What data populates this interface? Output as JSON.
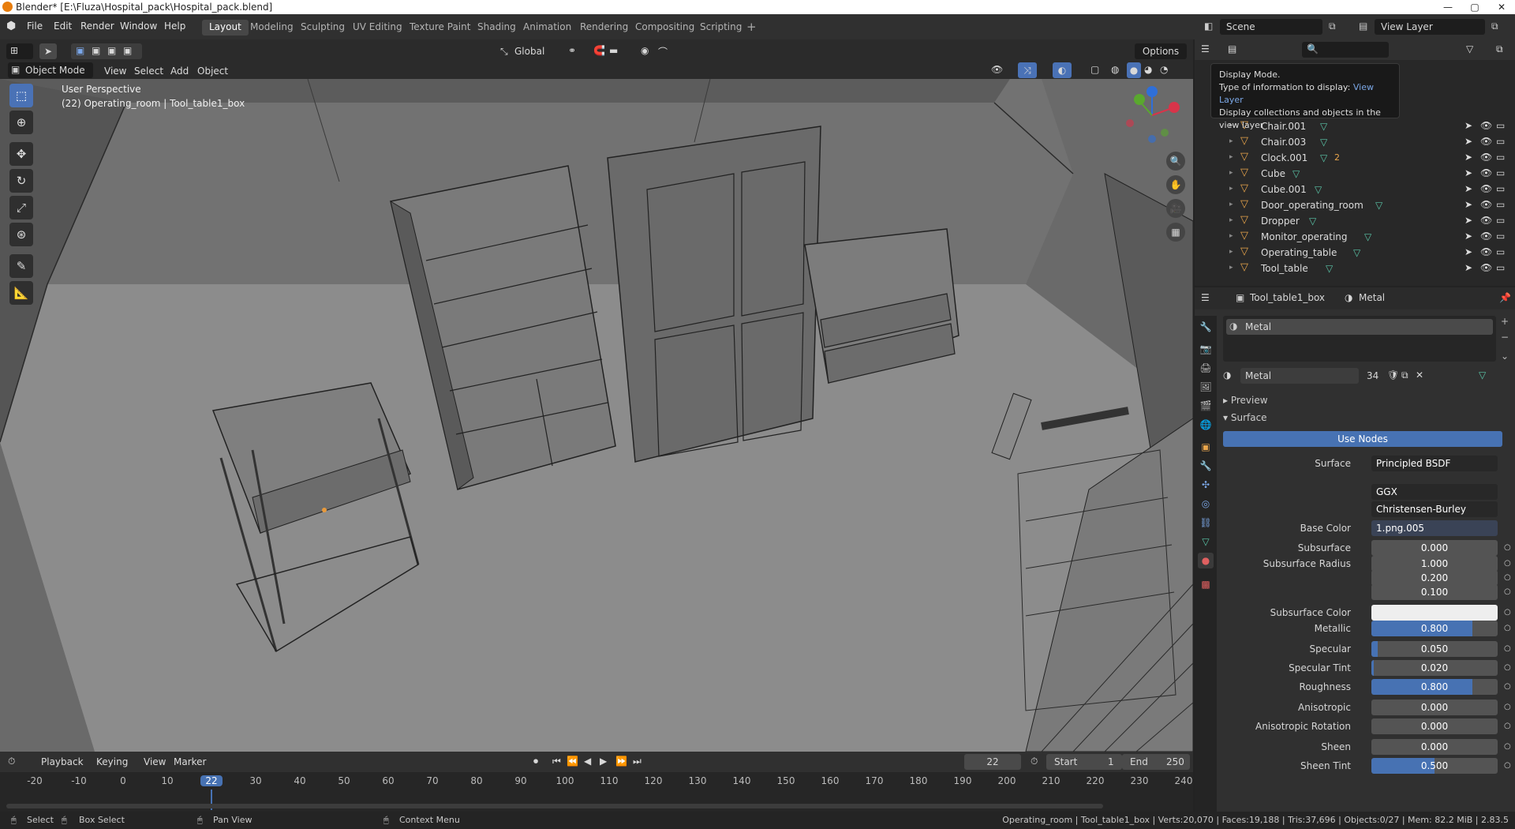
{
  "titlebar": {
    "title": "Blender* [E:\\Fluza\\Hospital_pack\\Hospital_pack.blend]",
    "btn_min": "—",
    "btn_max": "▢",
    "btn_close": "✕"
  },
  "menu": {
    "items": [
      "File",
      "Edit",
      "Render",
      "Window",
      "Help"
    ]
  },
  "workspaces": {
    "tabs": [
      "Layout",
      "Modeling",
      "Sculpting",
      "UV Editing",
      "Texture Paint",
      "Shading",
      "Animation",
      "Rendering",
      "Compositing",
      "Scripting"
    ],
    "active": "Layout",
    "add": "+"
  },
  "scene": {
    "label": "Scene",
    "view_layer": "View Layer"
  },
  "viewport_header": {
    "transform_orientation": "Global",
    "options": "Options",
    "mode": "Object Mode",
    "menus": [
      "View",
      "Select",
      "Add",
      "Object"
    ]
  },
  "viewport": {
    "perspective_label": "User Perspective",
    "object_label": "(22) Operating_room | Tool_table1_box"
  },
  "tooltip": {
    "title": "Display Mode.",
    "line2_prefix": "Type of information to display:",
    "line2_value": "View Layer",
    "line3": "Display collections and objects in the view layer"
  },
  "outliner": {
    "items": [
      {
        "name": "Chair.001",
        "extra": ""
      },
      {
        "name": "Chair.003",
        "extra": ""
      },
      {
        "name": "Clock.001",
        "extra": "2"
      },
      {
        "name": "Cube",
        "extra": ""
      },
      {
        "name": "Cube.001",
        "extra": ""
      },
      {
        "name": "Door_operating_room",
        "extra": ""
      },
      {
        "name": "Dropper",
        "extra": ""
      },
      {
        "name": "Monitor_operating",
        "extra": ""
      },
      {
        "name": "Operating_table",
        "extra": ""
      },
      {
        "name": "Tool_table",
        "extra": ""
      }
    ]
  },
  "properties": {
    "object_name": "Tool_table1_box",
    "material_name": "Metal",
    "slot_name": "Metal",
    "material_field": "Metal",
    "user_count": "34",
    "panel_preview": "Preview",
    "panel_surface": "Surface",
    "use_nodes": "Use Nodes",
    "surface_label": "Surface",
    "surface_value": "Principled BSDF",
    "distribution": "GGX",
    "subsurface_method": "Christensen-Burley",
    "base_color_label": "Base Color",
    "base_color_value": "1.png.005",
    "rows": [
      {
        "label": "Subsurface",
        "value": "0.000",
        "fill": 0
      },
      {
        "label": "Subsurface Radius",
        "value": "1.000",
        "fill": 0
      },
      {
        "label": "",
        "value": "0.200",
        "fill": 0
      },
      {
        "label": "",
        "value": "0.100",
        "fill": 0
      },
      {
        "label": "Subsurface Color",
        "value": "",
        "fill": 0
      },
      {
        "label": "Metallic",
        "value": "0.800",
        "fill": 0.8
      },
      {
        "label": "Specular",
        "value": "0.050",
        "fill": 0.05
      },
      {
        "label": "Specular Tint",
        "value": "0.020",
        "fill": 0.02
      },
      {
        "label": "Roughness",
        "value": "0.800",
        "fill": 0.8
      },
      {
        "label": "Anisotropic",
        "value": "0.000",
        "fill": 0
      },
      {
        "label": "Anisotropic Rotation",
        "value": "0.000",
        "fill": 0
      },
      {
        "label": "Sheen",
        "value": "0.000",
        "fill": 0
      },
      {
        "label": "Sheen Tint",
        "value": "0.500",
        "fill": 0.5
      }
    ]
  },
  "timeline": {
    "menus": [
      "Playback",
      "Keying",
      "View",
      "Marker"
    ],
    "current_frame": "22",
    "start_label": "Start",
    "start": "1",
    "end_label": "End",
    "end": "250",
    "ticks": [
      "-20",
      "-10",
      "0",
      "10",
      "22",
      "30",
      "40",
      "50",
      "60",
      "70",
      "80",
      "90",
      "100",
      "110",
      "120",
      "130",
      "140",
      "150",
      "160",
      "170",
      "180",
      "190",
      "200",
      "210",
      "220",
      "230",
      "240"
    ]
  },
  "statusbar": {
    "select": "Select",
    "box_select": "Box Select",
    "pan_view": "Pan View",
    "context_menu": "Context Menu",
    "stats": "Operating_room | Tool_table1_box | Verts:20,070 | Faces:19,188 | Tris:37,696 | Objects:0/27 | Mem: 82.2 MiB | 2.83.5"
  },
  "colors": {
    "accent": "#4772b3",
    "object_icon": "#e9a54b",
    "mesh_icon": "#5ac6a8",
    "viewport_bg": "#6e6e6e"
  }
}
